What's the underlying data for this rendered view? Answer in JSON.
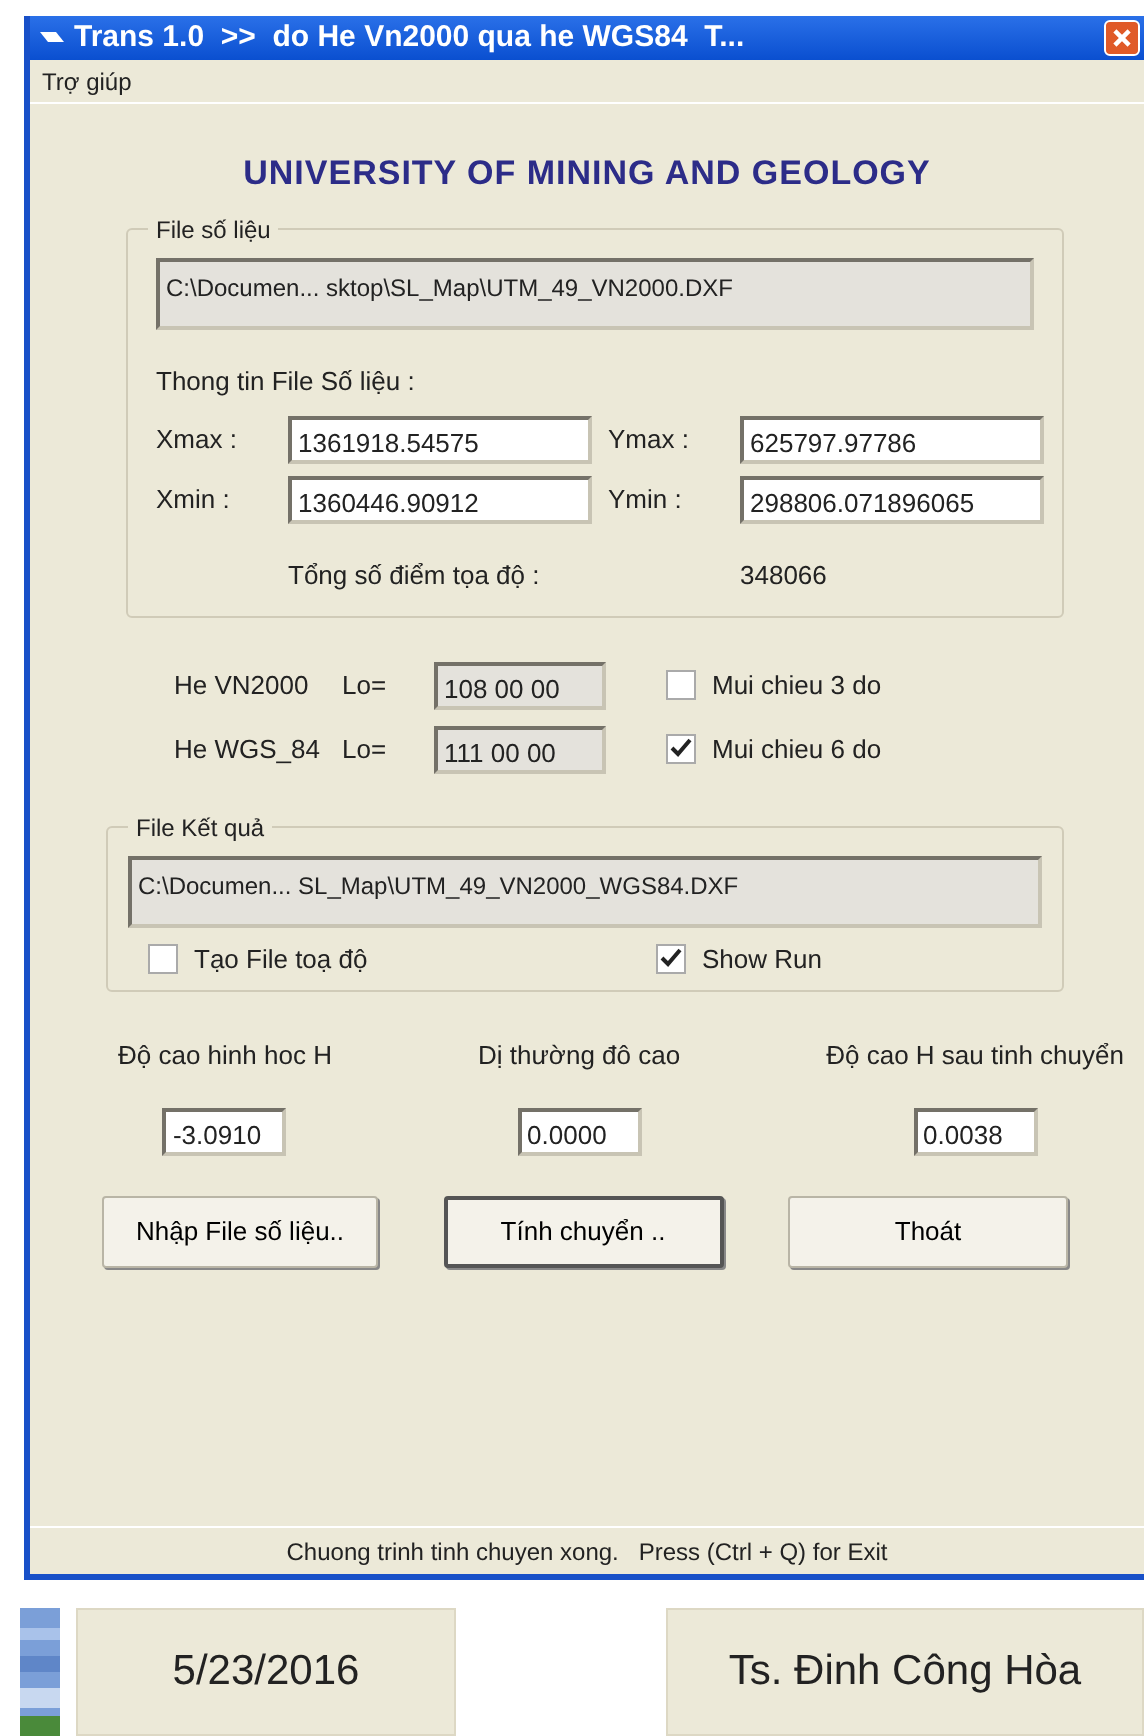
{
  "window": {
    "title": "Trans 1.0  >>  do He Vn2000 qua he WGS84  T..."
  },
  "menu": [
    "Trợ giúp"
  ],
  "heading": "UNIVERSITY OF MINING AND GEOLOGY",
  "input_group": {
    "label": "File số liệu",
    "path": "C:\\Documen... sktop\\SL_Map\\UTM_49_VN2000.DXF",
    "info_label": "Thong tin File Số liệu :",
    "fields": [
      {
        "label": "Xmax :",
        "value": "1361918.54575"
      },
      {
        "label": "Ymax :",
        "value": "625797.97786"
      },
      {
        "label": "Xmin :",
        "value": "1360446.90912"
      },
      {
        "label": "Ymin :",
        "value": "298806.071896065"
      }
    ],
    "total_label": "Tổng số  điểm tọa độ :",
    "total": "348066"
  },
  "systems": [
    {
      "name": "He VN2000",
      "lo_label": "Lo=",
      "lo_value": "108 00 00",
      "option": "Mui chieu 3 do",
      "checked": false
    },
    {
      "name": "He WGS_84",
      "lo_label": "Lo=",
      "lo_value": "111 00 00",
      "option": "Mui chieu 6 do",
      "checked": true
    }
  ],
  "output_group": {
    "label": "File Kết quả",
    "path": "C:\\Documen... SL_Map\\UTM_49_VN2000_WGS84.DXF",
    "options": [
      {
        "label": "Tạo File toạ độ",
        "checked": false
      },
      {
        "label": "Show Run",
        "checked": true
      }
    ]
  },
  "heights": [
    {
      "label": "Độ cao hinh hoc H",
      "value": "-3.0910"
    },
    {
      "label": "Dị thường đô cao",
      "value": "0.0000"
    },
    {
      "label": "Độ cao H sau tinh chuyển",
      "value": "0.0038"
    }
  ],
  "buttons": [
    {
      "label": "Nhập File số liệu..",
      "default": false
    },
    {
      "label": "Tính chuyển ..",
      "default": true
    },
    {
      "label": "Thoát",
      "default": false
    }
  ],
  "status_bar": "Chuong trinh tinh chuyen xong.   Press (Ctrl + Q) for Exit",
  "desktop": {
    "date": "5/23/2016",
    "author": "Ts. Đinh Công Hòa"
  }
}
